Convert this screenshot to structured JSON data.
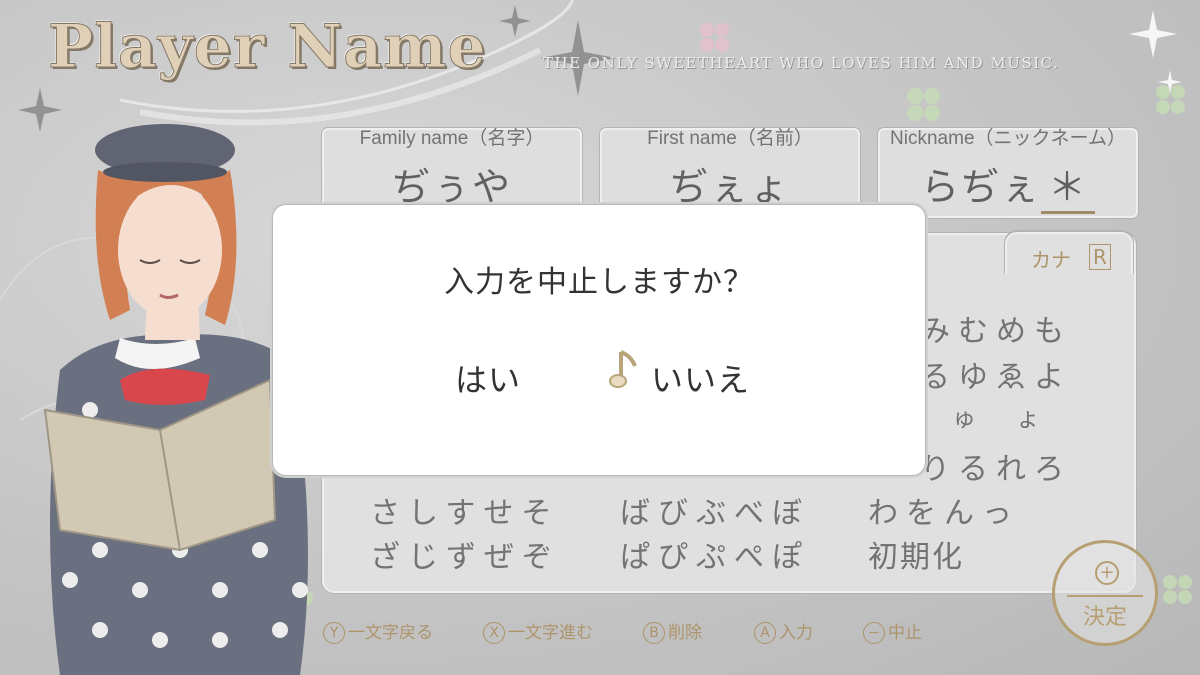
{
  "header": {
    "title": "Player Name",
    "subtitle": "THE ONLY SWEETHEART WHO LOVES HIM AND MUSIC."
  },
  "fields": {
    "family": {
      "label": "Family name（名字）",
      "value": "ぢぅや"
    },
    "first": {
      "label": "First name（名前）",
      "value": "ぢぇょ"
    },
    "nickname": {
      "label": "Nickname（ニックネーム）",
      "value": "らぢぇ",
      "cursor": "＊"
    }
  },
  "kana_panel": {
    "tab_label": "カナ",
    "tab_button": "R",
    "rows_right": [
      "みむめも",
      "るゆゑよ",
      "　ゅ　ょ",
      "りるれろ"
    ],
    "row5": [
      "さしすせそ",
      "ばびぶべぼ",
      "わをんっ"
    ],
    "row6": [
      "ざじずぜぞ",
      "ぱぴぷぺぽ",
      "初期化"
    ]
  },
  "decide": {
    "icon": "+",
    "label": "決定"
  },
  "hints": [
    {
      "button": "Y",
      "label": "一文字戻る"
    },
    {
      "button": "X",
      "label": "一文字進む"
    },
    {
      "button": "B",
      "label": "削除"
    },
    {
      "button": "A",
      "label": "入力"
    },
    {
      "button": "−",
      "label": "中止"
    }
  ],
  "dialog": {
    "message": "入力を中止しますか？",
    "yes": "はい",
    "no": "いいえ",
    "selected": "no",
    "selector_icon": "music-note-icon"
  },
  "colors": {
    "accent": "#9b7d4b",
    "background": "#b9b9b9"
  }
}
